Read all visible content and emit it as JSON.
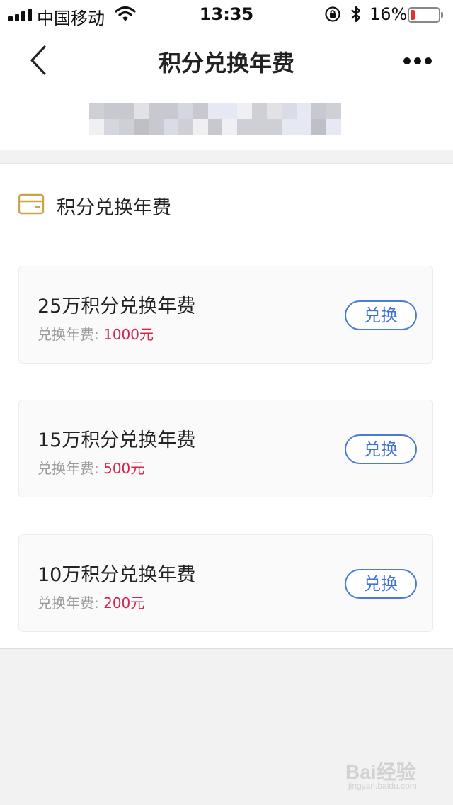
{
  "status_bar": {
    "carrier": "中国移动",
    "time": "13:35",
    "battery_percent": "16%",
    "battery_level": 0.16,
    "icons": [
      "signal-icon",
      "wifi-icon",
      "orientation-lock-icon",
      "bluetooth-icon",
      "battery-icon"
    ]
  },
  "nav": {
    "title": "积分兑换年费",
    "back_icon": "chevron-left-icon",
    "more_icon": "more-dots-icon"
  },
  "section": {
    "title": "积分兑换年费",
    "icon": "credit-card-icon",
    "icon_color": "#c9a64a"
  },
  "offers": [
    {
      "title": "25万积分兑换年费",
      "fee_label": "兑换年费: ",
      "fee_amount": "1000元",
      "button_label": "兑换"
    },
    {
      "title": "15万积分兑换年费",
      "fee_label": "兑换年费: ",
      "fee_amount": "500元",
      "button_label": "兑换"
    },
    {
      "title": "10万积分兑换年费",
      "fee_label": "兑换年费: ",
      "fee_amount": "200元",
      "button_label": "兑换"
    }
  ],
  "colors": {
    "accent_blue": "#4a7cd6",
    "amount_red": "#d0264d",
    "gold": "#c9a64a"
  },
  "watermark": {
    "logo": "Bai经验",
    "sub": "jingyan.baidu.com"
  }
}
